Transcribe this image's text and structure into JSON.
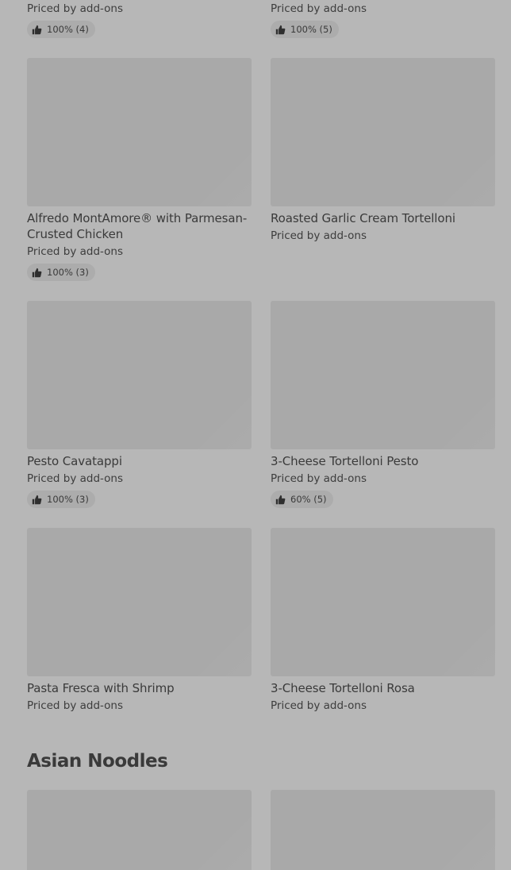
{
  "items": [
    {
      "title": "",
      "price": "Priced by add-ons",
      "rating": "100% (4)"
    },
    {
      "title": "",
      "price": "Priced by add-ons",
      "rating": "100% (5)"
    },
    {
      "title": "Alfredo MontAmore® with Parmesan-Crusted Chicken",
      "price": "Priced by add-ons",
      "rating": "100% (3)"
    },
    {
      "title": "Roasted Garlic Cream Tortelloni",
      "price": "Priced by add-ons",
      "rating": ""
    },
    {
      "title": "Pesto Cavatappi",
      "price": "Priced by add-ons",
      "rating": "100% (3)"
    },
    {
      "title": "3-Cheese Tortelloni Pesto",
      "price": "Priced by add-ons",
      "rating": "60% (5)"
    },
    {
      "title": "Pasta Fresca with Shrimp",
      "price": "Priced by add-ons",
      "rating": ""
    },
    {
      "title": "3-Cheese Tortelloni Rosa",
      "price": "Priced by add-ons",
      "rating": ""
    }
  ],
  "sections": {
    "asian_noodles": "Asian Noodles"
  },
  "icons": {
    "rating": "thumbs-up-icon"
  }
}
